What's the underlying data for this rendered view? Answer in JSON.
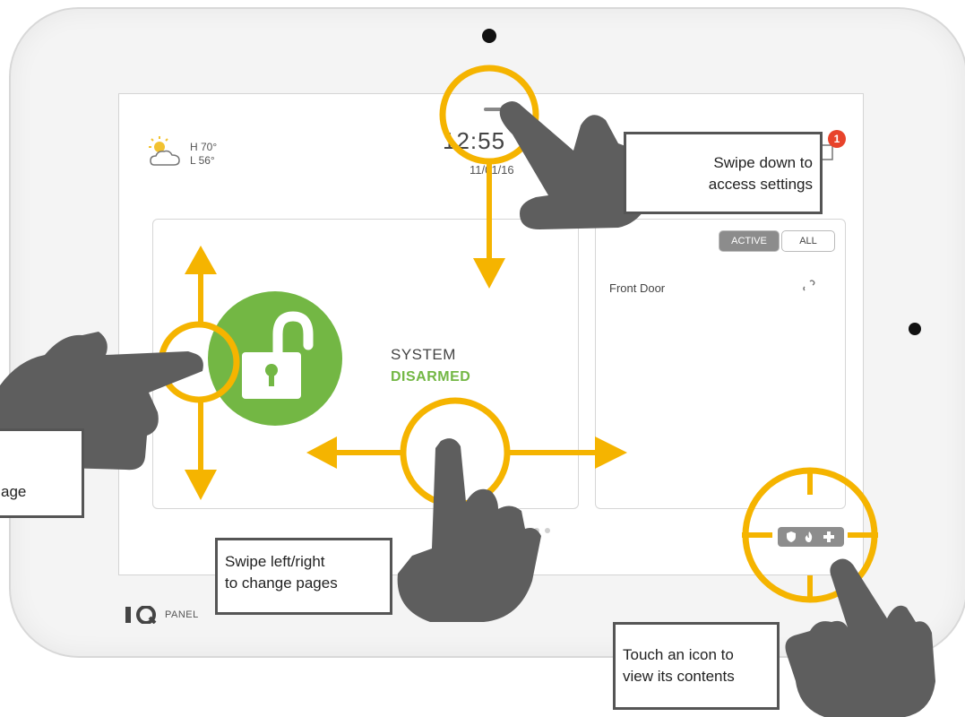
{
  "device": {
    "brand": "PANEL"
  },
  "header": {
    "weather_high": "H 70°",
    "weather_low": "L 56°",
    "time": "12:55",
    "date": "11/01/16",
    "notification_count": "1"
  },
  "status": {
    "line1": "SYSTEM",
    "line2": "DISARMED",
    "color": "#73b744"
  },
  "sensors": {
    "tabs": [
      {
        "label": "ACTIVE",
        "selected": true
      },
      {
        "label": "ALL",
        "selected": false
      }
    ],
    "items": [
      {
        "name": "Front Door"
      }
    ]
  },
  "quick_icons": [
    "shield-icon",
    "fire-icon",
    "plus-icon"
  ],
  "callouts": {
    "settings_line1": "Swipe down to",
    "settings_line2": "access settings",
    "pages_line1": "Swipe left/right",
    "pages_line2": "to change pages",
    "icon_line1": "Touch an icon to",
    "icon_line2": "view its contents",
    "left_partial": "age"
  },
  "colors": {
    "accent": "#f5b400",
    "hand": "#5e5e5e",
    "badge": "#e8432b"
  }
}
